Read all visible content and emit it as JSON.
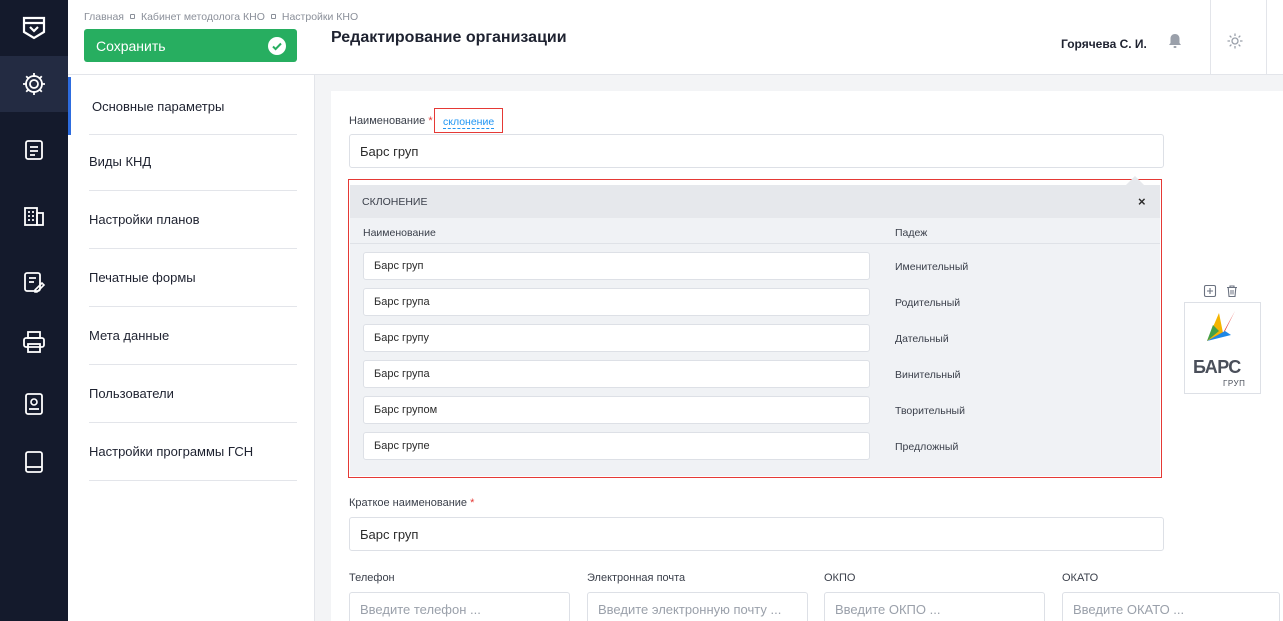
{
  "breadcrumb": [
    "Главная",
    "Кабинет методолога КНО",
    "Настройки КНО"
  ],
  "header": {
    "save_label": "Сохранить",
    "page_title": "Редактирование организации",
    "user_name": "Горячева С. И."
  },
  "rail_icons": [
    "logo-icon",
    "gear-icon",
    "document-icon",
    "building-icon",
    "edit-document-icon",
    "printer-icon",
    "settings-book-icon",
    "book-icon"
  ],
  "sidebar": {
    "items": [
      {
        "label": "Основные параметры",
        "active": true
      },
      {
        "label": "Виды КНД"
      },
      {
        "label": "Настройки планов"
      },
      {
        "label": "Печатные формы"
      },
      {
        "label": "Мета данные"
      },
      {
        "label": "Пользователи"
      },
      {
        "label": "Настройки программы ГСН"
      }
    ]
  },
  "form": {
    "name_label": "Наименование",
    "required_mark": "*",
    "declension_link": "склонение",
    "name_value": "Барс груп",
    "short_name_label": "Краткое наименование",
    "short_name_value": "Барс груп",
    "phone_label": "Телефон",
    "phone_placeholder": "Введите телефон ...",
    "email_label": "Электронная почта",
    "email_placeholder": "Введите электронную почту ...",
    "okpo_label": "ОКПО",
    "okpo_placeholder": "Введите ОКПО ...",
    "okato_label": "ОКАТО",
    "okato_placeholder": "Введите ОКАТО ..."
  },
  "declension": {
    "title": "СКЛОНЕНИЕ",
    "close": "×",
    "col_name": "Наименование",
    "col_case": "Падеж",
    "rows": [
      {
        "value": "Барс груп",
        "case": "Именительный"
      },
      {
        "value": "Барс групa",
        "case": "Родительный"
      },
      {
        "value": "Барс групу",
        "case": "Дательный"
      },
      {
        "value": "Барс групa",
        "case": "Винительный"
      },
      {
        "value": "Барс групом",
        "case": "Творительный"
      },
      {
        "value": "Барс групе",
        "case": "Предложный"
      }
    ]
  },
  "logo": {
    "brand_top": "БАРС",
    "brand_bottom": "ГРУП"
  },
  "colors": {
    "rail_bg": "#141a2c",
    "save_green": "#27ae60",
    "accent_blue": "#2d6cdf",
    "link_blue": "#2196f3",
    "highlight_red": "#e53935"
  }
}
